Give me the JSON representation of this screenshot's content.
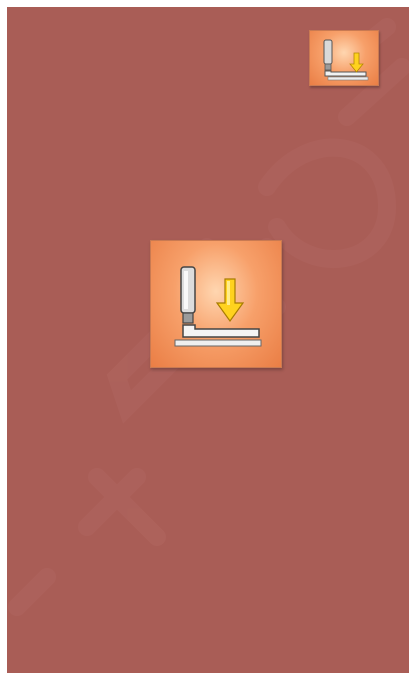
{
  "screen": {
    "background_color": "#a95d56"
  },
  "buttons": [
    {
      "name": "presser-foot-lower-small-button",
      "icon": "presser-foot-lower-icon"
    },
    {
      "name": "presser-foot-lower-large-button",
      "icon": "presser-foot-lower-icon"
    }
  ],
  "colors": {
    "button_face": "#f7a06a",
    "arrow": "#ffd21e",
    "needle_bar": "#d9d9d9"
  }
}
